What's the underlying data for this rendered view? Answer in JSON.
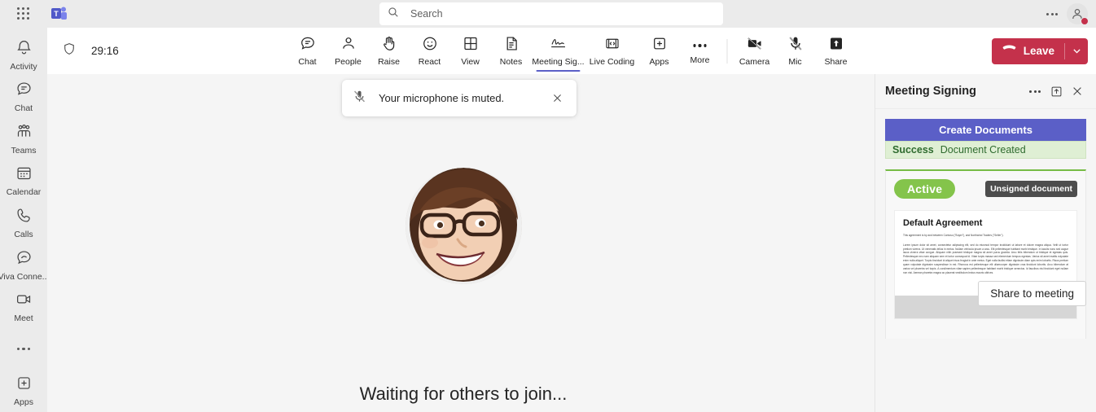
{
  "app": {
    "name": "Microsoft Teams",
    "logo_icon": "teams-logo-icon"
  },
  "topbar": {
    "waffle_icon": "app-launcher-grid-icon",
    "search": {
      "icon": "search-icon",
      "placeholder": "Search",
      "value": ""
    },
    "more_icon": "more-options-icon",
    "avatar_icon": "user-avatar-icon",
    "presence_status_color": "#c4314b"
  },
  "rail": {
    "items": [
      {
        "label": "Activity",
        "icon": "bell-icon"
      },
      {
        "label": "Chat",
        "icon": "chat-bubble-icon"
      },
      {
        "label": "Teams",
        "icon": "teams-people-icon"
      },
      {
        "label": "Calendar",
        "icon": "calendar-icon"
      },
      {
        "label": "Calls",
        "icon": "phone-icon"
      },
      {
        "label": "Viva Conne...",
        "icon": "viva-connections-icon"
      },
      {
        "label": "Meet",
        "icon": "video-camera-icon"
      }
    ],
    "more_icon": "more-apps-icon",
    "apps": {
      "label": "Apps",
      "icon": "add-plus-box-icon"
    }
  },
  "meeting": {
    "shield_icon": "shield-security-icon",
    "timer": "29:16",
    "tools": [
      {
        "label": "Chat",
        "icon": "chat-bubble-icon",
        "active": false
      },
      {
        "label": "People",
        "icon": "person-icon",
        "active": false
      },
      {
        "label": "Raise",
        "icon": "raise-hand-icon",
        "active": false
      },
      {
        "label": "React",
        "icon": "smiley-react-icon",
        "active": false
      },
      {
        "label": "View",
        "icon": "grid-view-icon",
        "active": false
      },
      {
        "label": "Notes",
        "icon": "notes-icon",
        "active": false
      },
      {
        "label": "Meeting Sig...",
        "icon": "signature-icon",
        "active": true
      },
      {
        "label": "Live Coding",
        "icon": "live-coding-icon",
        "active": false
      },
      {
        "label": "Apps",
        "icon": "add-plus-box-icon",
        "active": false
      },
      {
        "label": "More",
        "icon": "more-options-icon",
        "active": false
      }
    ],
    "device_tools": [
      {
        "label": "Camera",
        "icon": "camera-off-icon"
      },
      {
        "label": "Mic",
        "icon": "mic-off-icon"
      },
      {
        "label": "Share",
        "icon": "share-screen-icon"
      }
    ],
    "leave": {
      "label": "Leave",
      "icon": "hangup-phone-icon",
      "chevron_icon": "chevron-down-icon",
      "color": "#c4314b"
    },
    "accent_color": "#5b5fc7"
  },
  "toast": {
    "icon": "mic-off-icon",
    "message": "Your microphone is muted.",
    "close_icon": "close-icon"
  },
  "stage": {
    "avatar_name": "participant-avatar",
    "waiting_text": "Waiting for others to join..."
  },
  "panel": {
    "title": "Meeting Signing",
    "more_icon": "more-options-icon",
    "popout_icon": "pop-out-icon",
    "close_icon": "close-icon",
    "create_button": "Create Documents",
    "status": {
      "word": "Success",
      "message": "Document Created",
      "bg_color": "#dfefd4",
      "text_color": "#2f6b2f"
    },
    "document": {
      "state_badge": "Active",
      "state_badge_color": "#84c44b",
      "tooltip": "Unsigned document",
      "tooltip_color": "#4d4d4d",
      "title": "Default Agreement",
      "intro": "This agreement is by and between Contoso (\"Buyer\"), and Northwind Traders (\"Seller\").",
      "body": "Lorem ipsum dolor sit amet, consectetur adipiscing elit, sed do eiusmod tempor incididunt ut labore et dolore magna aliqua. Velit ut tortor pretium viverra. Ut venenatis tellus in metus. Nullam vehicula ipsum a arcu. Elit pellentesque habitant morbi tristique. In iaculis nunc sed augue lacus viverra vitae congue. Aliquam nibh praesent tristique magna sit amet purus gravida. Arcu felis bibendum ut tristique et egestas quis. Pellentesque nec nam aliquam sem et tortor consequat id. Vitae turpis massa sed elementum tempus egestas. Varius sit amet mattis vulputate enim nulla aliquet. Turpis tincidunt id aliquet risus feugiat in ante metus. Eget nulla facilisi etiam dignissim diam quis enim lobortis. Risus pretium quam vulputate dignissim suspendisse in est. Rhoncus est pellentesque elit ullamcorper dignissim cras tincidunt lobortis. Arcu bibendum at varius vel pharetra vel turpis. A condimentum vitae sapien pellentesque habitant morbi tristique senectus. Id faucibus nisl tincidunt eget nullam non nisi. Aenean pharetra magna ac placerat vestibulum lectus mauris ultrices."
    },
    "share_button": "Share to meeting"
  }
}
